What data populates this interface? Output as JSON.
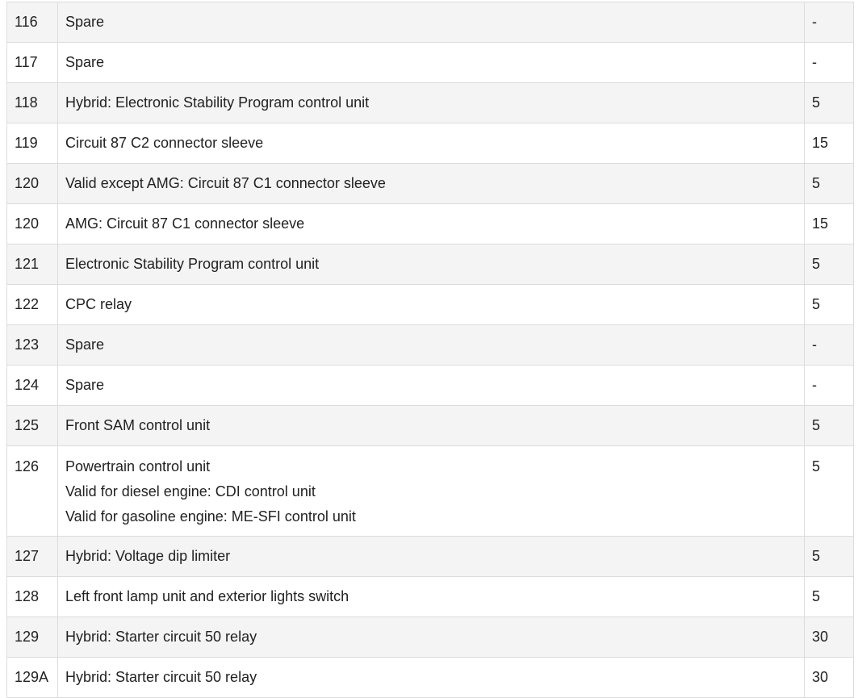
{
  "fuse_table": {
    "rows": [
      {
        "number": "116",
        "function": [
          "Spare"
        ],
        "rating": "-"
      },
      {
        "number": "117",
        "function": [
          "Spare"
        ],
        "rating": "-"
      },
      {
        "number": "118",
        "function": [
          "Hybrid: Electronic Stability Program control unit"
        ],
        "rating": "5"
      },
      {
        "number": "119",
        "function": [
          "Circuit 87 C2 connector sleeve"
        ],
        "rating": "15"
      },
      {
        "number": "120",
        "function": [
          "Valid except AMG: Circuit 87 C1 connector sleeve"
        ],
        "rating": "5"
      },
      {
        "number": "120",
        "function": [
          "AMG: Circuit 87 C1 connector sleeve"
        ],
        "rating": "15"
      },
      {
        "number": "121",
        "function": [
          "Electronic Stability Program control unit"
        ],
        "rating": "5"
      },
      {
        "number": "122",
        "function": [
          "CPC relay"
        ],
        "rating": "5"
      },
      {
        "number": "123",
        "function": [
          "Spare"
        ],
        "rating": "-"
      },
      {
        "number": "124",
        "function": [
          "Spare"
        ],
        "rating": "-"
      },
      {
        "number": "125",
        "function": [
          "Front SAM control unit"
        ],
        "rating": "5"
      },
      {
        "number": "126",
        "function": [
          "Powertrain control unit",
          "Valid for diesel engine: CDI control unit",
          "Valid for gasoline engine: ME-SFI control unit"
        ],
        "rating": "5"
      },
      {
        "number": "127",
        "function": [
          "Hybrid: Voltage dip limiter"
        ],
        "rating": "5"
      },
      {
        "number": "128",
        "function": [
          "Left front lamp unit and exterior lights switch"
        ],
        "rating": "5"
      },
      {
        "number": "129",
        "function": [
          "Hybrid: Starter circuit 50 relay"
        ],
        "rating": "30"
      },
      {
        "number": "129A",
        "function": [
          "Hybrid: Starter circuit 50 relay"
        ],
        "rating": "30"
      }
    ]
  }
}
